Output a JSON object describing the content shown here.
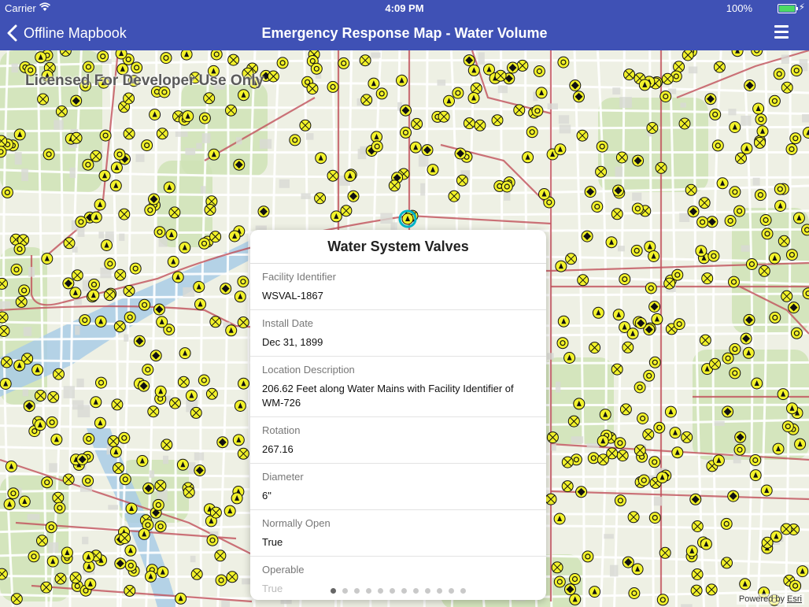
{
  "status_bar": {
    "carrier": "Carrier",
    "time": "4:09 PM",
    "battery": "100%"
  },
  "nav": {
    "back_label": "Offline Mapbook",
    "title": "Emergency Response Map - Water Volume"
  },
  "map": {
    "watermark": "Licensed For Developer Use Only",
    "attribution_prefix": "Powered by",
    "attribution_brand": "Esri"
  },
  "popup": {
    "title": "Water System Valves",
    "fields": [
      {
        "label": "Facility Identifier",
        "value": "WSVAL-1867"
      },
      {
        "label": "Install Date",
        "value": "Dec 31, 1899"
      },
      {
        "label": "Location Description",
        "value": "206.62 Feet along Water Mains with Facility Identifier of WM-726"
      },
      {
        "label": "Rotation",
        "value": "267.16"
      },
      {
        "label": "Diameter",
        "value": "6\""
      },
      {
        "label": "Normally Open",
        "value": "True"
      },
      {
        "label": "Operable",
        "value": "True"
      }
    ],
    "page_count": 12,
    "current_page": 1
  },
  "colors": {
    "nav_bar": "#3f51b5",
    "valve_fill": "#f2f22a",
    "main_line": "#c0505a",
    "park": "#cfe3b6",
    "river": "#a9cde6",
    "selected": "#00b5c8"
  }
}
